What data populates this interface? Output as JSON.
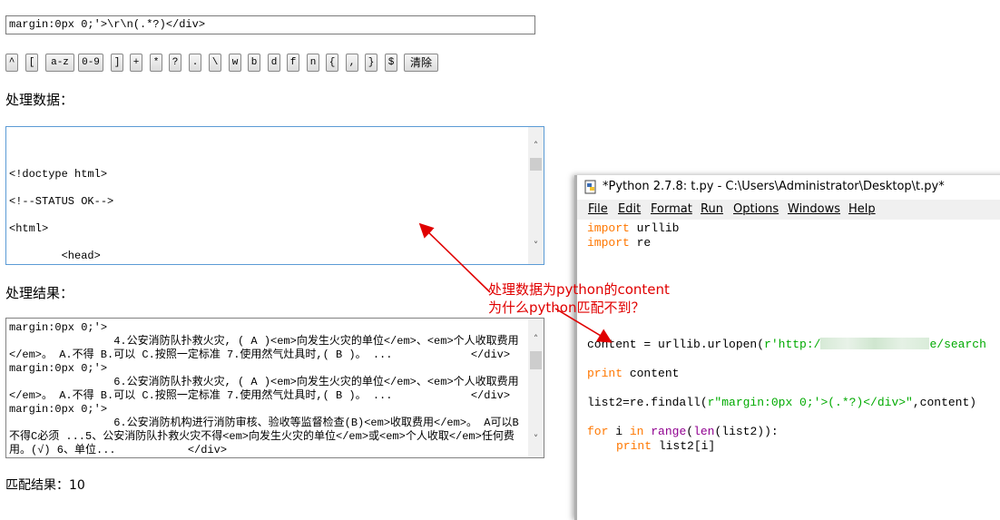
{
  "regex_input": {
    "value": "margin:0px 0;'>\\r\\n(.*?)</div>"
  },
  "buttons": [
    "^",
    "[",
    "a-z",
    "0-9",
    "]",
    "+",
    "*",
    "?",
    ".",
    "\\",
    "w",
    "b",
    "d",
    "f",
    "n",
    "{",
    ",",
    "}",
    "$",
    "清除"
  ],
  "labels": {
    "data": "处理数据：",
    "result": "处理结果：",
    "match_prefix": "匹配结果：",
    "match_count": "10"
  },
  "data_lines": [
    "<!doctype html>",
    "<!--STATUS OK-->",
    "<html>",
    "        <head>"
  ],
  "result_lines": [
    "margin:0px 0;'>",
    "                4.公安消防队扑救火灾, ( A )<em>向发生火灾的单位</em>、<em>个人收取费用",
    "</em>。 A.不得 B.可以 C.按照一定标准 7.使用然气灶具时,( B )。 ...            </div>",
    "margin:0px 0;'>",
    "                6.公安消防队扑救火灾, ( A )<em>向发生火灾的单位</em>、<em>个人收取费用",
    "</em>。 A.不得 B.可以 C.按照一定标准 7.使用然气灶具时,( B )。 ...            </div>",
    "margin:0px 0;'>",
    "                6.公安消防机构进行消防审核、验收等监督检查(B)<em>收取费用</em>。 A可以B",
    "不得C必须 ...5、公安消防队扑救火灾不得<em>向发生火灾的单位</em>或<em>个人收取</em>任何费",
    "用。(√) 6、单位...           </div>"
  ],
  "annotation": {
    "line1": "处理数据为python的content",
    "line2": "为什么python匹配不到？",
    "color": "#e00000"
  },
  "idle": {
    "title": "*Python 2.7.8: t.py - C:\\Users\\Administrator\\Desktop\\t.py*",
    "menu": [
      "File",
      "Edit",
      "Format",
      "Run",
      "Options",
      "Windows",
      "Help"
    ],
    "code": {
      "l1_kw": "import",
      "l1_rest": " urllib",
      "l2_kw": "import",
      "l2_rest": " re",
      "l3_a": "content = urllib.urlopen(",
      "l3_str1": "r'http:/",
      "l3_str2": "e/search",
      "l4_kw": "print",
      "l4_rest": " content",
      "l5_a": "list2=re.findall(",
      "l5_str": "r\"margin:0px 0;'>(.*?)</div>\"",
      "l5_b": ",content)",
      "l6_kw1": "for",
      "l6_b": " i ",
      "l6_kw2": "in",
      "l6_sp": " ",
      "l6_bi1": "range",
      "l6_c": "(",
      "l6_bi2": "len",
      "l6_d": "(list2)):",
      "l7_kw": "print",
      "l7_rest": " list2[i]"
    }
  }
}
